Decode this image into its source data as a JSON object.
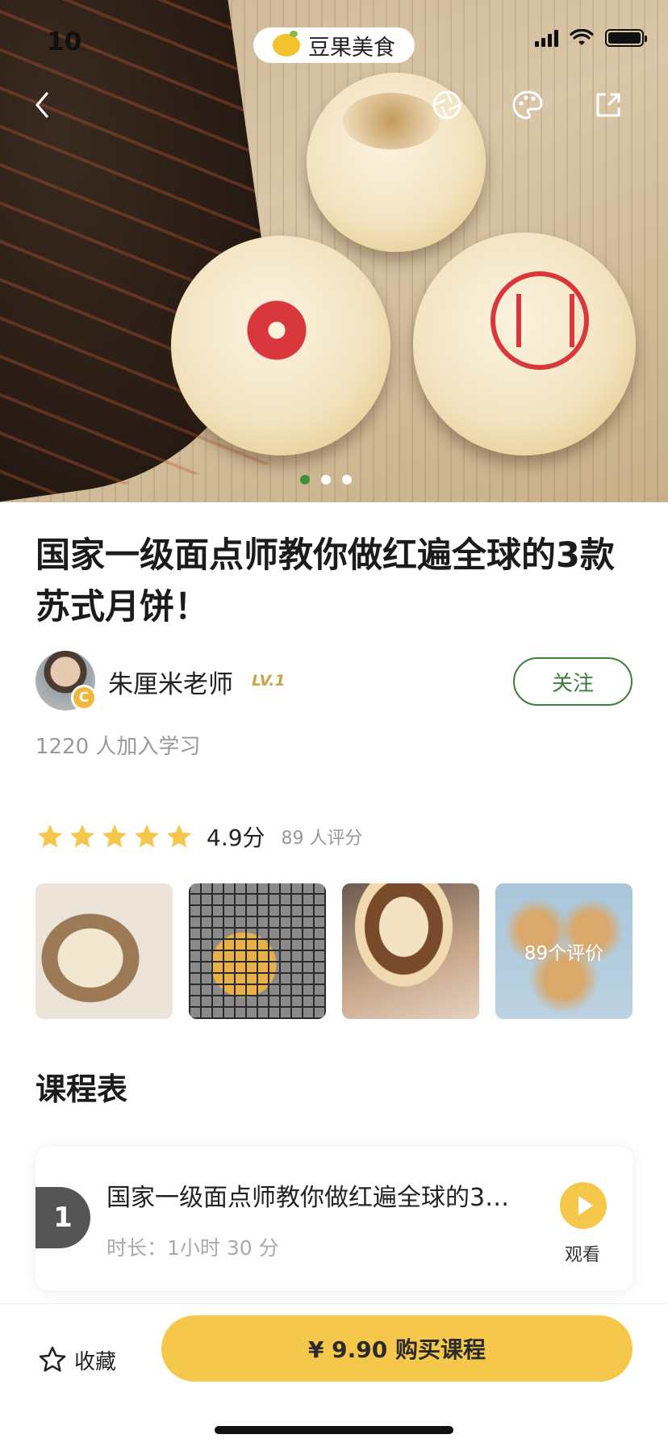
{
  "status_bar": {
    "time": "10"
  },
  "app_badge": {
    "name": "豆果美食"
  },
  "carousel": {
    "total": 3,
    "active_index": 0
  },
  "course": {
    "title": "国家一级面点师教你做红遍全球的3款苏式月饼！",
    "author_name": "朱厘米老师",
    "author_level": "LV.1",
    "author_badge": "C",
    "follow_label": "关注",
    "joined_text": "1220 人加入学习"
  },
  "rating": {
    "stars": 5,
    "max_stars": 5,
    "score_text": "4.9分",
    "count_text": "89 人评分"
  },
  "reviews": {
    "more_label": "89个评价"
  },
  "schedule": {
    "heading": "课程表",
    "lessons": [
      {
        "number": "1",
        "title": "国家一级面点师教你做红遍全球的3款苏式月饼！",
        "duration": "时长：1小时 30 分",
        "watch_label": "观看"
      }
    ]
  },
  "bottom_bar": {
    "favorite_label": "收藏",
    "buy_label": "¥ 9.90 购买课程"
  },
  "colors": {
    "accent_green": "#3f7d3a",
    "buy_yellow": "#f5c84c",
    "star_yellow": "#f5c84c"
  },
  "icons": [
    "back-icon",
    "camera-shutter-icon",
    "palette-icon",
    "share-icon",
    "star-icon",
    "play-icon",
    "favorite-star-icon"
  ]
}
